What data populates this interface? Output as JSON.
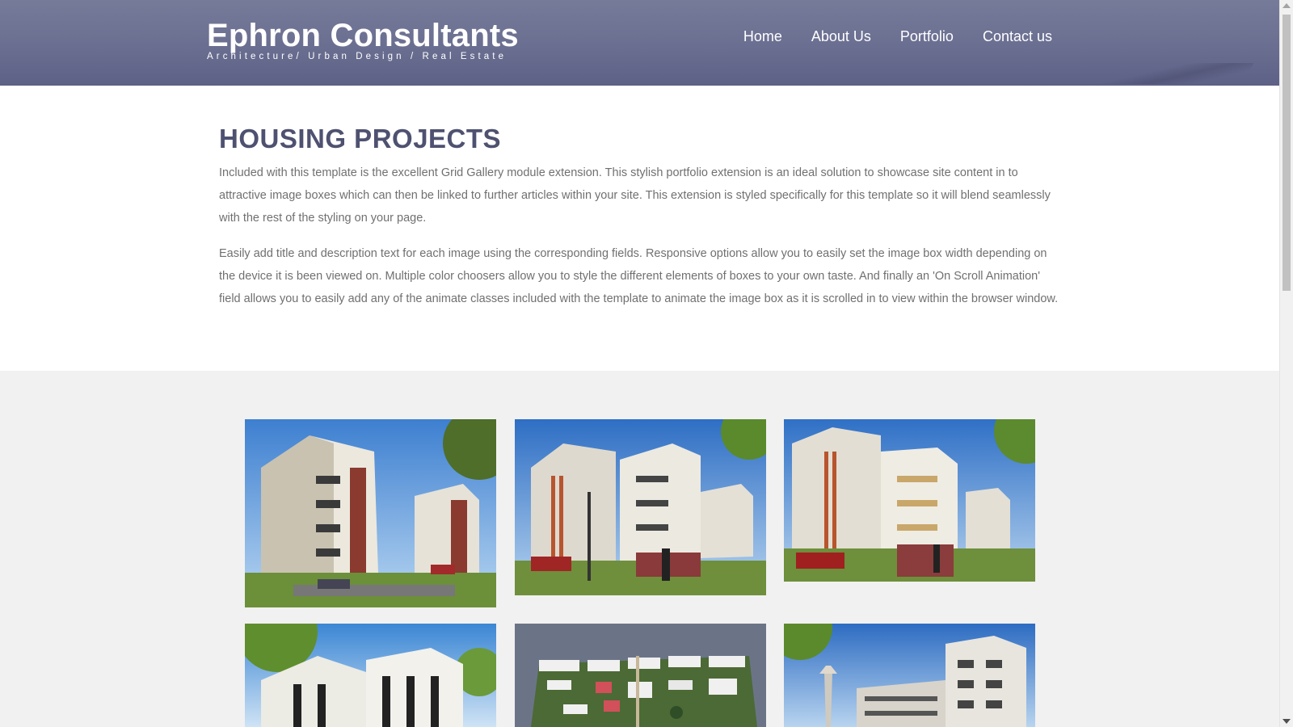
{
  "brand": {
    "title": "Ephron Consultants",
    "tagline": "Architecture/ Urban Design / Real Estate"
  },
  "nav": {
    "items": [
      {
        "label": "Home"
      },
      {
        "label": "About Us"
      },
      {
        "label": "Portfolio"
      },
      {
        "label": "Contact us"
      }
    ]
  },
  "intro": {
    "title": "HOUSING PROJECTS",
    "paragraphs": [
      "Included with this template is the excellent Grid Gallery module extension. This stylish portfolio extension is an ideal solution to showcase site content in to attractive image boxes which can then be linked to further articles within your site. This extension is styled specifically for this template so it will blend seamlessly with the rest of the styling on your page.",
      "Easily add title and description text for each image using the corresponding fields. Responsive options allow you to easily set the image box width depending on the device it is been viewed on. Multiple color choosers allow you to style the different elements of boxes to your own taste. And finally an 'On Scroll Animation' field allows you to easily add any of the animate classes included with the template to animate the image box as it is scrolled in to view within the browser window."
    ]
  },
  "gallery": {
    "images": [
      {
        "name": "apartment-render-1"
      },
      {
        "name": "apartment-render-2"
      },
      {
        "name": "apartment-render-3"
      },
      {
        "name": "villa-render"
      },
      {
        "name": "masterplan-render"
      },
      {
        "name": "tower-render"
      }
    ]
  },
  "colors": {
    "header_bg": "#6a6e90",
    "title": "#4e5170",
    "body_text": "#707070",
    "gallery_bg": "#f1f1f1"
  }
}
